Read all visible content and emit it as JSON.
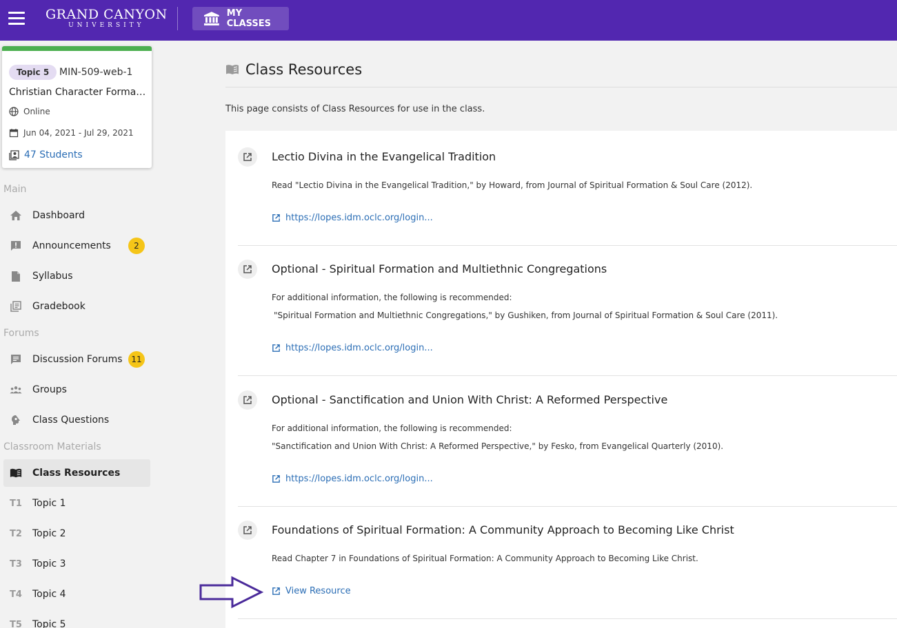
{
  "header": {
    "logo_line1": "GRAND CANYON",
    "logo_line2": "UNIVERSITY",
    "myclasses_label": "MY CLASSES"
  },
  "course_card": {
    "topic": "Topic 5",
    "code": "MIN-509-web-1",
    "name": "Christian Character Formation",
    "mode": "Online",
    "dates": "Jun 04, 2021 - Jul 29, 2021",
    "students": "47 Students",
    "accent_color": "#4caf50"
  },
  "sidebar": {
    "section_main": "Main",
    "section_forums": "Forums",
    "section_materials": "Classroom Materials",
    "items": [
      {
        "label": "Dashboard",
        "icon": "home-icon"
      },
      {
        "label": "Announcements",
        "icon": "announcement-icon",
        "badge": "2"
      },
      {
        "label": "Syllabus",
        "icon": "document-icon"
      },
      {
        "label": "Gradebook",
        "icon": "gradebook-icon"
      },
      {
        "label": "Discussion Forums",
        "icon": "forum-icon",
        "badge": "11"
      },
      {
        "label": "Groups",
        "icon": "groups-icon"
      },
      {
        "label": "Class Questions",
        "icon": "question-icon"
      },
      {
        "label": "Class Resources",
        "icon": "book-icon",
        "active": true
      },
      {
        "label": "Topic 1",
        "code": "T1"
      },
      {
        "label": "Topic 2",
        "code": "T2"
      },
      {
        "label": "Topic 3",
        "code": "T3"
      },
      {
        "label": "Topic 4",
        "code": "T4"
      },
      {
        "label": "Topic 5",
        "code": "T5"
      }
    ]
  },
  "main": {
    "title": "Class Resources",
    "intro": "This page consists of Class Resources for use in the class.",
    "resources": [
      {
        "title": "Lectio Divina in the Evangelical Tradition",
        "desc1": "Read \"Lectio Divina in the Evangelical Tradition,\" by Howard, from Journal of Spiritual Formation & Soul Care (2012).",
        "link": "https://lopes.idm.oclc.org/login..."
      },
      {
        "title": "Optional - Spiritual Formation and Multiethnic Congregations",
        "desc1": "For additional information, the following is recommended:",
        "desc2": "\"Spiritual Formation and Multiethnic Congregations,\" by Gushiken, from Journal of Spiritual Formation & Soul Care (2011).",
        "link": "https://lopes.idm.oclc.org/login..."
      },
      {
        "title": "Optional - Sanctification and Union With Christ: A Reformed Perspective",
        "desc1": "For additional information, the following is recommended:",
        "desc2": "\"Sanctification and Union With Christ: A Reformed Perspective,\" by Fesko, from Evangelical Quarterly (2010).",
        "link": "https://lopes.idm.oclc.org/login..."
      },
      {
        "title": "Foundations of Spiritual Formation: A Community Approach to Becoming Like Christ",
        "desc1": "Read Chapter 7 in Foundations of Spiritual Formation: A Community Approach to Becoming Like Christ.",
        "link": "View Resource"
      }
    ]
  },
  "colors": {
    "header": "#5227b0",
    "link": "#2a6db5",
    "badge": "#f5c518",
    "annotation_arrow": "#4a2a9a"
  }
}
